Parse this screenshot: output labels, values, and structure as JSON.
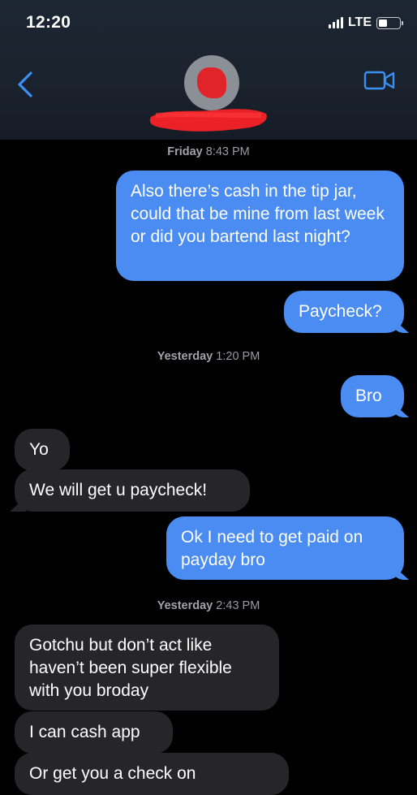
{
  "status_bar": {
    "time": "12:20",
    "network": "LTE"
  },
  "conversation": {
    "back_icon": "chevron-left-icon",
    "video_icon": "video-camera-icon",
    "avatar_icon": "contact-avatar",
    "accent": "#4a8cf2"
  },
  "messages": [
    {
      "type": "timestamp",
      "day": "Friday",
      "time": "8:43 PM"
    },
    {
      "type": "sent",
      "text": "Also there’s cash in the tip jar, could that be mine from last week or did you bartend last night?"
    },
    {
      "type": "sent",
      "text": "Paycheck?"
    },
    {
      "type": "timestamp",
      "day": "Yesterday",
      "time": "1:20 PM"
    },
    {
      "type": "sent",
      "text": "Bro"
    },
    {
      "type": "received",
      "text": "Yo"
    },
    {
      "type": "received",
      "text": "We will get u paycheck!"
    },
    {
      "type": "sent",
      "text": "Ok I need to get paid on payday bro"
    },
    {
      "type": "timestamp",
      "day": "Yesterday",
      "time": "2:43 PM"
    },
    {
      "type": "received",
      "text": "Gotchu but don’t act like haven’t been super flexible with you broday"
    },
    {
      "type": "received",
      "text": "I can cash app"
    },
    {
      "type": "received",
      "text": "Or get you a check on"
    }
  ]
}
